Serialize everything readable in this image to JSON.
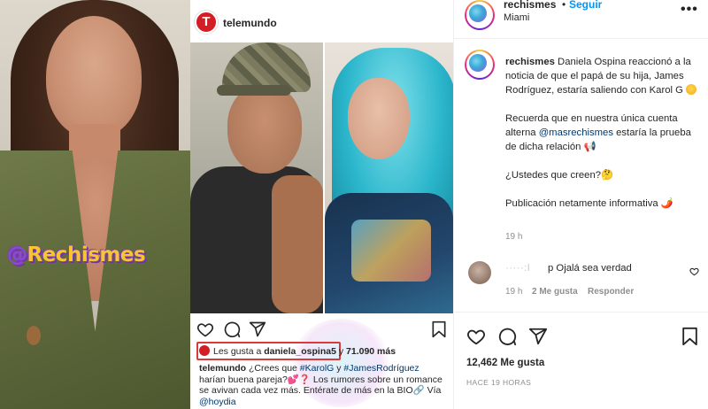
{
  "media": {
    "watermark_at": "@",
    "watermark_text": "Rechismes",
    "card": {
      "username": "telemundo",
      "logo_letter": "T",
      "likes_prefix": "Les gusta a ",
      "likes_user": "daniela_ospina5",
      "likes_mid": " y ",
      "likes_count": "71.090 más",
      "caption_user": "telemundo",
      "caption_part1": " ¿Crees que ",
      "caption_tag1": "#KarolG",
      "caption_part2": " y ",
      "caption_tag2": "#JamesRodríguez",
      "caption_part3": " harían buena pareja?💕❓ Los rumores sobre un romance se avivan cada vez más. Entérate de más en la BIO🔗 Vía ",
      "caption_tag3": "@hoydia"
    }
  },
  "post": {
    "username": "rechismes",
    "separator": "•",
    "follow_label": "Seguir",
    "location": "Miami",
    "more_label": "•••",
    "caption_user": "rechismes",
    "caption_p1": " Daniela Ospina reaccionó a la noticia de que el papá de su hija, James Rodríguez, estaría saliendo con Karol G",
    "caption_p2_a": "Recuerda que en nuestra única cuenta alterna ",
    "caption_p2_mention": "@masrechismes",
    "caption_p2_b": " estaría la prueba de dicha relación 📢",
    "caption_p3": "¿Ustedes que creen?🤔",
    "caption_p4": "Publicación netamente informativa 🌶️",
    "caption_time": "19 h",
    "comment": {
      "user_obscured": "·····:l",
      "text": "p Ojalá sea verdad",
      "time": "19 h",
      "likes": "2 Me gusta",
      "reply": "Responder"
    },
    "likes_count": "12,462 Me gusta",
    "date": "HACE 19 HORAS"
  },
  "colors": {
    "accent_blue": "#0095f6",
    "mention_blue": "#00376b",
    "muted": "#8e8e8e",
    "highlight_red": "#d93a3a",
    "telemundo_red": "#d31e25"
  },
  "icons": [
    "heart-icon",
    "comment-icon",
    "share-icon",
    "bookmark-icon",
    "more-icon"
  ]
}
